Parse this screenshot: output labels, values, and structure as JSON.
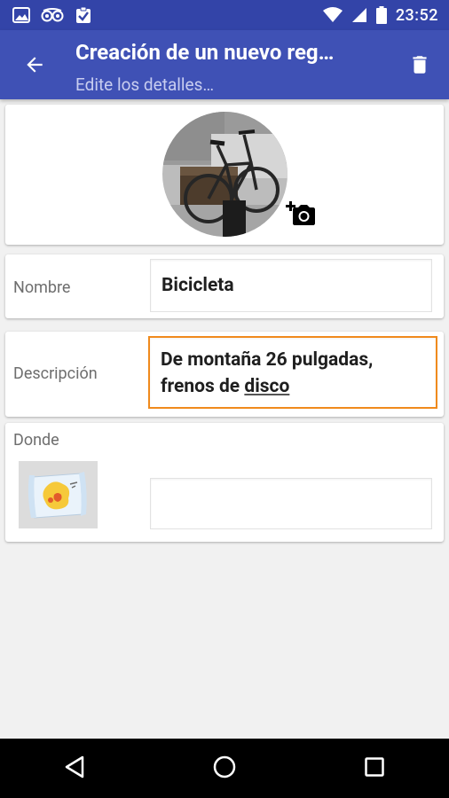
{
  "status_bar": {
    "time": "23:52",
    "icons": [
      "image-icon",
      "tripadvisor-icon",
      "clipboard-check-icon",
      "wifi-icon",
      "signal-icon",
      "battery-icon"
    ]
  },
  "app_bar": {
    "title": "Creación de un nuevo reg…",
    "subtitle": "Edite los detalles…",
    "back_icon": "arrow-back-icon",
    "delete_icon": "delete-icon",
    "background": "#3f51b5",
    "status_background": "#3344a8"
  },
  "photo": {
    "add_photo_icon": "add-photo-icon"
  },
  "fields": {
    "name": {
      "label": "Nombre",
      "value": "Bicicleta"
    },
    "description": {
      "label": "Descripción",
      "value_prefix": "De montaña 26 pulgadas, frenos de ",
      "value_underlined": "disco",
      "focused": true,
      "focus_color": "#f08a1c"
    },
    "where": {
      "label": "Donde",
      "value": "",
      "map_icon": "map-icon"
    }
  },
  "nav_bar": {
    "back": "nav-back-icon",
    "home": "nav-home-icon",
    "recents": "nav-recents-icon"
  }
}
